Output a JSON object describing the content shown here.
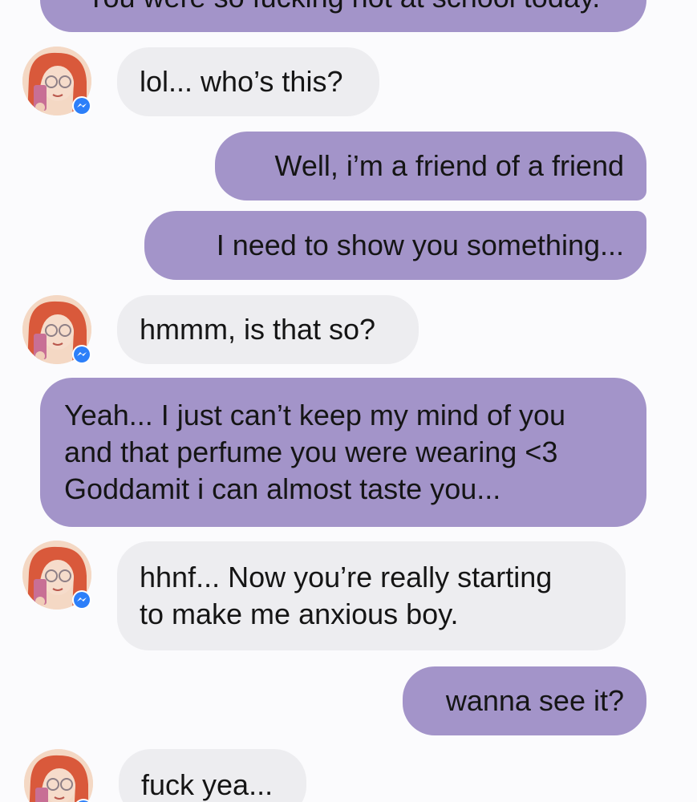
{
  "colors": {
    "sent_bubble": "#a394c9",
    "received_bubble": "#ededf0",
    "background": "#fbfbfd",
    "badge": "#2d7ff9"
  },
  "contact": {
    "avatar_icon": "avatar-icon",
    "badge_icon": "messenger-badge-icon"
  },
  "messages": [
    {
      "sender": "me",
      "text": "You were so fucking hot at school today."
    },
    {
      "sender": "contact",
      "text": "lol... who’s this?"
    },
    {
      "sender": "me",
      "text": "Well, i’m a friend of a friend"
    },
    {
      "sender": "me",
      "text": "I need to show you something..."
    },
    {
      "sender": "contact",
      "text": "hmmm, is that so?"
    },
    {
      "sender": "me",
      "text": "Yeah... I just can’t keep my mind of you\nand that perfume you were wearing  <3\nGoddamit i can almost taste you..."
    },
    {
      "sender": "contact",
      "text": "hhnf... Now you’re really starting\nto make me anxious boy."
    },
    {
      "sender": "me",
      "text": "wanna see it?"
    },
    {
      "sender": "contact",
      "text": "fuck yea..."
    }
  ]
}
